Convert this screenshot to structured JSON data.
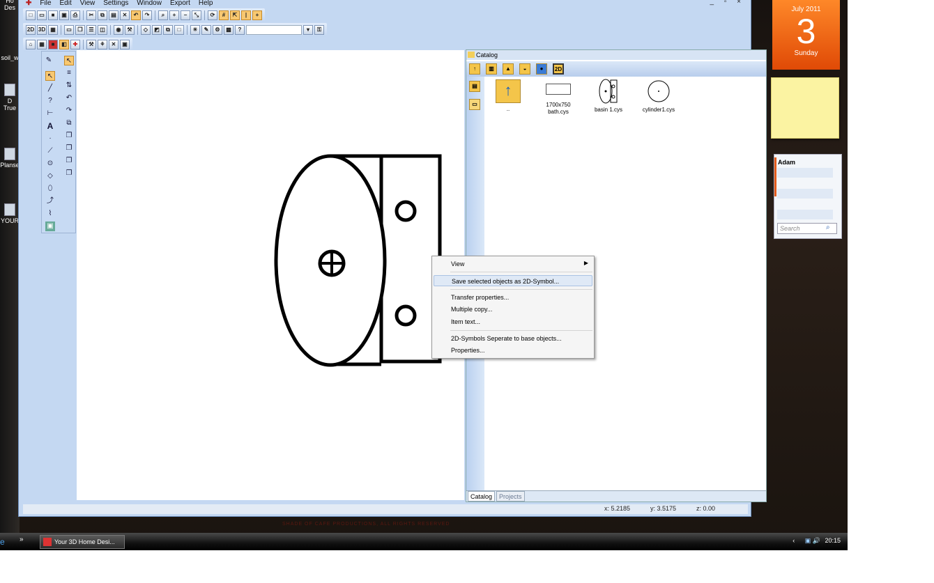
{
  "desktop": {
    "icons": [
      {
        "label": "Ho",
        "label2": "Des"
      },
      {
        "label": "soil_w"
      },
      {
        "label": "D",
        "label2": "True"
      },
      {
        "label": "Planse"
      },
      {
        "label": "YOUR"
      }
    ],
    "wallpaper_text": "SHADE OF CAFE PRODUCTIONS, ALL RIGHTS RESERVED"
  },
  "app": {
    "menu": [
      "File",
      "Edit",
      "View",
      "Settings",
      "Window",
      "Export",
      "Help"
    ],
    "window_controls": "_ ▫ ×",
    "catalog": {
      "title": "Catalog",
      "files": [
        {
          "name": "..",
          "icon": "up-folder-icon"
        },
        {
          "name": "1700x750 bath.cys",
          "icon": "bath-icon"
        },
        {
          "name": "basin 1.cys",
          "icon": "basin-icon"
        },
        {
          "name": "cylinder1.cys",
          "icon": "cylinder-icon"
        }
      ],
      "tabs": [
        "Catalog",
        "Projects"
      ]
    },
    "status": {
      "x": "x: 5.2185",
      "y": "y: 3.5175",
      "z": "z: 0.00"
    },
    "context_menu": [
      {
        "label": "View",
        "submenu": true
      },
      {
        "label": "Save selected objects as 2D-Symbol...",
        "highlighted": true
      },
      {
        "label": "Transfer properties..."
      },
      {
        "label": "Multiple copy..."
      },
      {
        "label": "Item text..."
      },
      {
        "label": "2D-Symbols Seperate to base objects..."
      },
      {
        "label": "Properties..."
      }
    ]
  },
  "gadgets": {
    "calendar": {
      "month_year": "July 2011",
      "day": "3",
      "weekday": "Sunday"
    },
    "contacts": {
      "user": "Adam",
      "search_placeholder": "Search"
    }
  },
  "taskbar": {
    "task_label": "Your 3D Home Desi...",
    "time": "20:15",
    "tray_arrow": "‹"
  }
}
